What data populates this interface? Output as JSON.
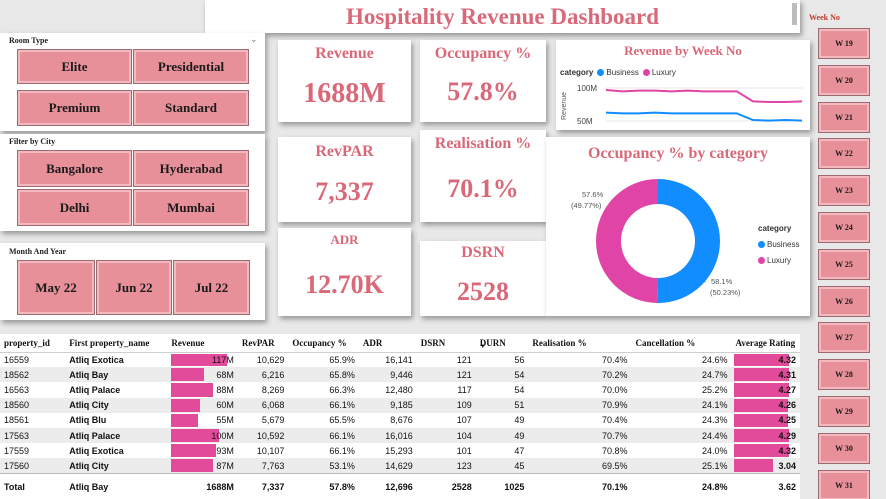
{
  "header": {
    "title": "Hospitality Revenue Dashboard"
  },
  "room_type": {
    "title": "Room Type",
    "options": [
      "Elite",
      "Presidential",
      "Premium",
      "Standard"
    ]
  },
  "city": {
    "title": "Filter by City",
    "options": [
      "Bangalore",
      "Hyderabad",
      "Delhi",
      "Mumbai"
    ]
  },
  "month": {
    "title": "Month And Year",
    "options": [
      "May 22",
      "Jun 22",
      "Jul 22"
    ]
  },
  "kpis": {
    "revenue": {
      "label": "Revenue",
      "value": "1688M"
    },
    "occupancy": {
      "label": "Occupancy %",
      "value": "57.8%"
    },
    "revpar": {
      "label": "RevPAR",
      "value": "7,337"
    },
    "realisation": {
      "label": "Realisation %",
      "value": "70.1%"
    },
    "adr": {
      "label": "ADR",
      "value": "12.70K"
    },
    "dsrn": {
      "label": "DSRN",
      "value": "2528"
    }
  },
  "line_chart": {
    "title": "Revenue by Week No",
    "legend_title": "category",
    "y_axis_label": "Revenue",
    "y_ticks": [
      "100M",
      "50M"
    ],
    "series_names": [
      "Business",
      "Luxury"
    ],
    "colors": {
      "business": "#118dff",
      "luxury": "#e044a7"
    }
  },
  "donut_chart": {
    "title": "Occupancy % by category",
    "legend_title": "category",
    "series_names": [
      "Business",
      "Luxury"
    ],
    "label_luxury": [
      "57.6%",
      "(49.77%)"
    ],
    "label_business": [
      "58.1%",
      "(50.23%)"
    ]
  },
  "chart_data": [
    {
      "type": "line",
      "title": "Revenue by Week No",
      "ylabel": "Revenue",
      "xlabel": "",
      "ylim": [
        30,
        120
      ],
      "x": [
        19,
        20,
        21,
        22,
        23,
        24,
        25,
        26,
        27,
        28,
        29,
        30,
        31
      ],
      "series": [
        {
          "name": "Luxury",
          "values": [
            90,
            88,
            89,
            89,
            88,
            89,
            88,
            88,
            88,
            73,
            72,
            72,
            73
          ]
        },
        {
          "name": "Business",
          "values": [
            56,
            55,
            55,
            56,
            55,
            55,
            55,
            55,
            55,
            45,
            44,
            45,
            44
          ]
        }
      ]
    },
    {
      "type": "pie",
      "title": "Occupancy % by category",
      "categories": [
        "Business",
        "Luxury"
      ],
      "values": [
        50.23,
        49.77
      ]
    }
  ],
  "weeks": {
    "title": "Week No",
    "items": [
      "W 19",
      "W 20",
      "W 21",
      "W 22",
      "W 23",
      "W 24",
      "W 25",
      "W 26",
      "W 27",
      "W 28",
      "W 29",
      "W 30",
      "W 31"
    ]
  },
  "table": {
    "headers": [
      "property_id",
      "First property_name",
      "Revenue",
      "RevPAR",
      "Occupancy %",
      "ADR",
      "DSRN",
      "DURN",
      "Realisation %",
      "Cancellation %",
      "Average Rating"
    ],
    "revenue_max": 117,
    "rating_max": 4.5,
    "rows": [
      {
        "id": "16559",
        "name": "Atliq Exotica",
        "revenue": "117M",
        "rev_num": 117,
        "revpar": "10,629",
        "occ": "65.9%",
        "adr": "16,141",
        "dsrn": "121",
        "durn": "56",
        "real": "70.4%",
        "canc": "24.6%",
        "rating": "4.32",
        "rating_num": 4.32
      },
      {
        "id": "18562",
        "name": "Atliq Bay",
        "revenue": "68M",
        "rev_num": 68,
        "revpar": "6,216",
        "occ": "65.8%",
        "adr": "9,446",
        "dsrn": "121",
        "durn": "54",
        "real": "70.2%",
        "canc": "24.7%",
        "rating": "4.31",
        "rating_num": 4.31
      },
      {
        "id": "16563",
        "name": "Atliq Palace",
        "revenue": "88M",
        "rev_num": 88,
        "revpar": "8,269",
        "occ": "66.3%",
        "adr": "12,480",
        "dsrn": "117",
        "durn": "54",
        "real": "70.0%",
        "canc": "25.2%",
        "rating": "4.27",
        "rating_num": 4.27
      },
      {
        "id": "18560",
        "name": "Atliq City",
        "revenue": "60M",
        "rev_num": 60,
        "revpar": "6,068",
        "occ": "66.1%",
        "adr": "9,185",
        "dsrn": "109",
        "durn": "51",
        "real": "70.9%",
        "canc": "24.1%",
        "rating": "4.26",
        "rating_num": 4.26
      },
      {
        "id": "18561",
        "name": "Atliq Blu",
        "revenue": "55M",
        "rev_num": 55,
        "revpar": "5,679",
        "occ": "65.5%",
        "adr": "8,676",
        "dsrn": "107",
        "durn": "49",
        "real": "70.4%",
        "canc": "24.3%",
        "rating": "4.25",
        "rating_num": 4.25
      },
      {
        "id": "17563",
        "name": "Atliq Palace",
        "revenue": "100M",
        "rev_num": 100,
        "revpar": "10,592",
        "occ": "66.1%",
        "adr": "16,016",
        "dsrn": "104",
        "durn": "49",
        "real": "70.7%",
        "canc": "24.4%",
        "rating": "4.29",
        "rating_num": 4.29
      },
      {
        "id": "17559",
        "name": "Atliq Exotica",
        "revenue": "93M",
        "rev_num": 93,
        "revpar": "10,107",
        "occ": "66.1%",
        "adr": "15,293",
        "dsrn": "101",
        "durn": "47",
        "real": "70.8%",
        "canc": "24.0%",
        "rating": "4.32",
        "rating_num": 4.32
      },
      {
        "id": "17560",
        "name": "Atliq City",
        "revenue": "87M",
        "rev_num": 87,
        "revpar": "7,763",
        "occ": "53.1%",
        "adr": "14,629",
        "dsrn": "123",
        "durn": "45",
        "real": "69.5%",
        "canc": "25.1%",
        "rating": "3.04",
        "rating_num": 3.04
      }
    ],
    "total": {
      "label": "Total",
      "name": "Atliq Bay",
      "revenue": "1688M",
      "revpar": "7,337",
      "occ": "57.8%",
      "adr": "12,696",
      "dsrn": "2528",
      "durn": "1025",
      "real": "70.1%",
      "canc": "24.8%",
      "rating": "3.62"
    }
  }
}
